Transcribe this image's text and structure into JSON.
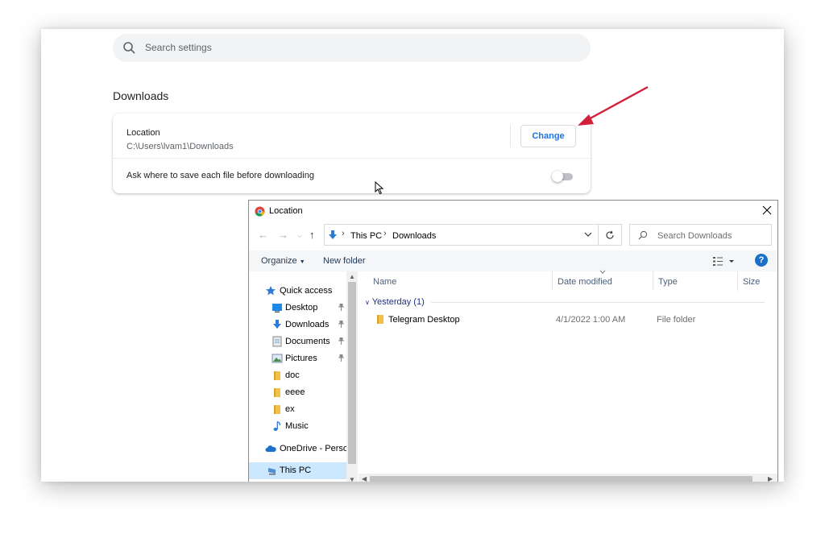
{
  "settings": {
    "search_placeholder": "Search settings",
    "section_title": "Downloads",
    "location_label": "Location",
    "location_path": "C:\\Users\\lvam1\\Downloads",
    "change_button": "Change",
    "ask_label": "Ask where to save each file before downloading",
    "ask_toggle_on": false
  },
  "dialog": {
    "title": "Location",
    "breadcrumb": [
      "This PC",
      "Downloads"
    ],
    "search_placeholder": "Search Downloads",
    "organize": "Organize",
    "new_folder": "New folder",
    "help": "?",
    "nav_items": [
      {
        "label": "Quick access",
        "icon": "star-icon"
      },
      {
        "label": "Desktop",
        "icon": "desktop-icon",
        "pinned": true
      },
      {
        "label": "Downloads",
        "icon": "download-arrow-icon",
        "pinned": true
      },
      {
        "label": "Documents",
        "icon": "document-icon",
        "pinned": true
      },
      {
        "label": "Pictures",
        "icon": "picture-icon",
        "pinned": true
      },
      {
        "label": "doc",
        "icon": "folder-icon"
      },
      {
        "label": "eeee",
        "icon": "folder-icon"
      },
      {
        "label": "ex",
        "icon": "folder-icon"
      },
      {
        "label": "Music",
        "icon": "music-note-icon"
      },
      {
        "label": "OneDrive - Person",
        "icon": "cloud-icon"
      },
      {
        "label": "This PC",
        "icon": "computer-icon",
        "selected": true
      }
    ],
    "columns": [
      "Name",
      "Date modified",
      "Type",
      "Size"
    ],
    "group": "Yesterday (1)",
    "files": [
      {
        "name": "Telegram Desktop",
        "date": "4/1/2022 1:00 AM",
        "type": "File folder"
      }
    ]
  },
  "colors": {
    "accent_blue": "#1a73e8",
    "annotation_arrow": "#d21f3c",
    "selected_row": "#cce8ff"
  }
}
